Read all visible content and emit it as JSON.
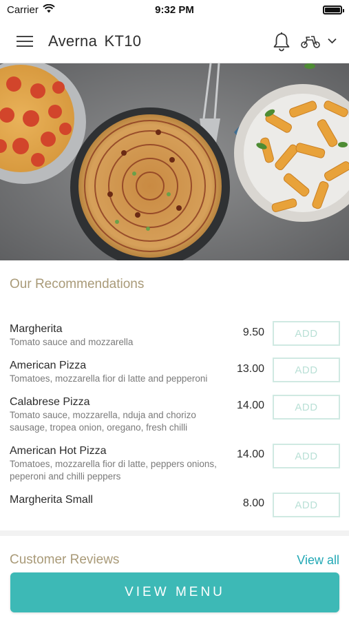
{
  "status_bar": {
    "carrier": "Carrier",
    "time": "9:32 PM"
  },
  "header": {
    "store_name": "Averna  KT10"
  },
  "recommendations": {
    "title": "Our Recommendations",
    "add_label": "ADD",
    "items": [
      {
        "name": "Margherita",
        "description": "Tomato sauce and mozzarella",
        "price": "9.50"
      },
      {
        "name": "American Pizza",
        "description": "Tomatoes, mozzarella fior di latte and pepperoni",
        "price": "13.00"
      },
      {
        "name": "Calabrese Pizza",
        "description": "Tomato sauce, mozzarella, nduja and chorizo sausage, tropea onion, oregano, fresh chilli",
        "price": "14.00"
      },
      {
        "name": "American Hot Pizza",
        "description": "Tomatoes, mozzarella fior di latte, peppers onions, peperoni and chilli peppers",
        "price": "14.00"
      },
      {
        "name": "Margherita Small",
        "description": "",
        "price": "8.00"
      }
    ]
  },
  "reviews": {
    "title": "Customer Reviews",
    "view_all": "View all"
  },
  "cta": {
    "view_menu": "VIEW MENU"
  },
  "colors": {
    "accent": "#3db9b6",
    "link": "#22a8b5",
    "section_title": "#a99a78",
    "add_border": "#cfe9e2"
  }
}
